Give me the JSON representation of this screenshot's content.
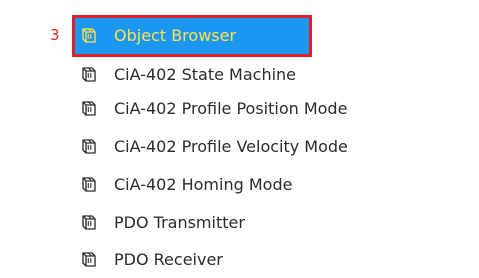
{
  "annotation": {
    "number": "3"
  },
  "object_tree": {
    "items": [
      {
        "label": "Object Browser",
        "icon": "cube-icon",
        "selected": true
      },
      {
        "label": "CiA-402 State Machine",
        "icon": "cube-icon"
      },
      {
        "label": "CiA-402 Profile Position Mode",
        "icon": "cube-icon"
      },
      {
        "label": "CiA-402 Profile Velocity Mode",
        "icon": "cube-icon"
      },
      {
        "label": "CiA-402 Homing Mode",
        "icon": "cube-icon"
      },
      {
        "label": "PDO Transmitter",
        "icon": "cube-icon"
      },
      {
        "label": "PDO Receiver",
        "icon": "cube-icon"
      }
    ]
  },
  "colors": {
    "selection_background": "#1c96f3",
    "selected_text": "#ffe34a",
    "annotation_red": "#e11f26",
    "text": "#2c2c2c"
  }
}
